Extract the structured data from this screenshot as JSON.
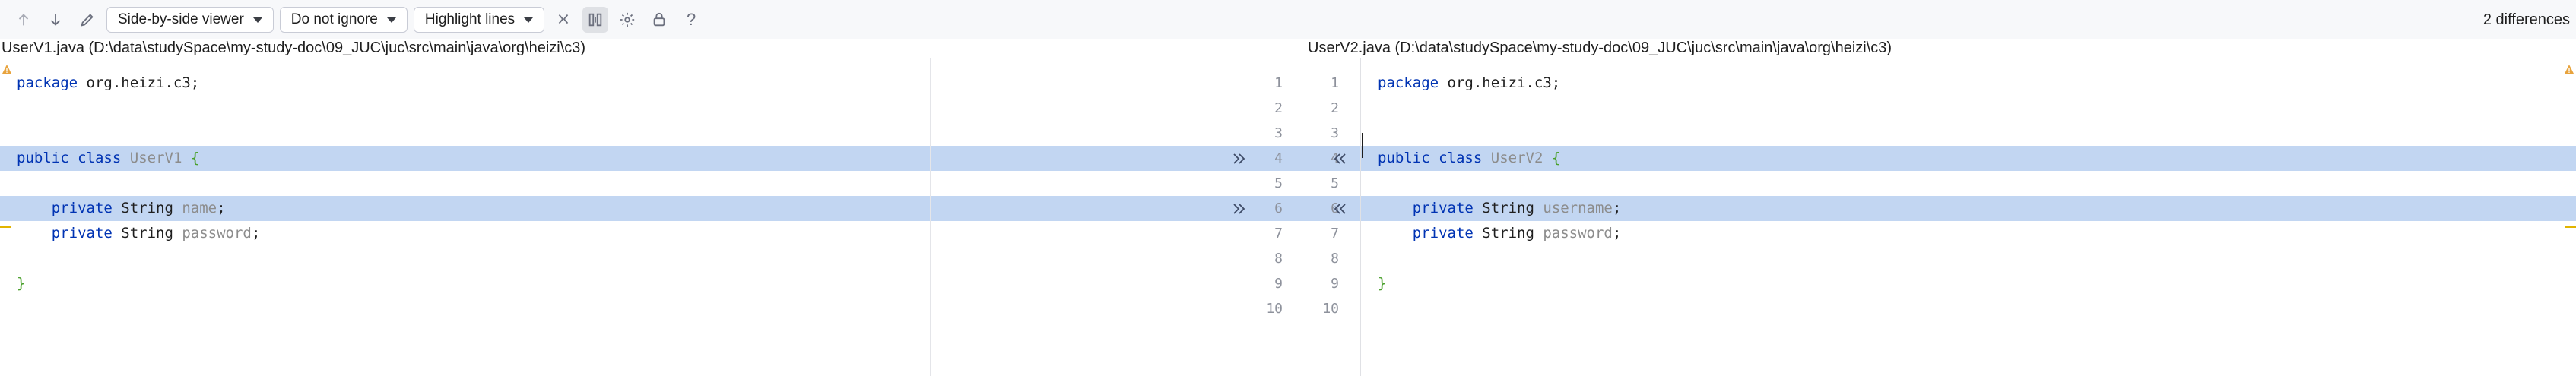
{
  "toolbar": {
    "viewer_label": "Side-by-side viewer",
    "ignore_label": "Do not ignore",
    "highlight_label": "Highlight lines",
    "diff_count": "2 differences",
    "help_label": "?"
  },
  "left": {
    "header": "UserV1.java (D:\\data\\studySpace\\my-study-doc\\09_JUC\\juc\\src\\main\\java\\org\\heizi\\c3)",
    "lines": [
      {
        "n": 1,
        "tokens": [
          {
            "t": "package",
            "c": "kw"
          },
          {
            "t": " org.heizi.c3;",
            "c": ""
          }
        ]
      },
      {
        "n": 2,
        "tokens": []
      },
      {
        "n": 3,
        "tokens": []
      },
      {
        "n": 4,
        "changed": true,
        "tokens": [
          {
            "t": "public",
            "c": "kw"
          },
          {
            "t": " ",
            "c": ""
          },
          {
            "t": "class",
            "c": "kw"
          },
          {
            "t": " ",
            "c": ""
          },
          {
            "t": "UserV1",
            "c": "cls"
          },
          {
            "t": " ",
            "c": ""
          },
          {
            "t": "{",
            "c": "brace"
          }
        ]
      },
      {
        "n": 5,
        "tokens": []
      },
      {
        "n": 6,
        "changed": true,
        "tokens": [
          {
            "t": "    ",
            "c": ""
          },
          {
            "t": "private",
            "c": "kw"
          },
          {
            "t": " String ",
            "c": ""
          },
          {
            "t": "name",
            "c": "fld"
          },
          {
            "t": ";",
            "c": ""
          }
        ]
      },
      {
        "n": 7,
        "tokens": [
          {
            "t": "    ",
            "c": ""
          },
          {
            "t": "private",
            "c": "kw"
          },
          {
            "t": " String ",
            "c": ""
          },
          {
            "t": "password",
            "c": "fld"
          },
          {
            "t": ";",
            "c": ""
          }
        ]
      },
      {
        "n": 8,
        "tokens": []
      },
      {
        "n": 9,
        "tokens": [
          {
            "t": "}",
            "c": "brace"
          }
        ]
      },
      {
        "n": 10,
        "tokens": []
      }
    ]
  },
  "right": {
    "header": "UserV2.java (D:\\data\\studySpace\\my-study-doc\\09_JUC\\juc\\src\\main\\java\\org\\heizi\\c3)",
    "lines": [
      {
        "n": 1,
        "tokens": [
          {
            "t": "package",
            "c": "kw"
          },
          {
            "t": " org.heizi.c3;",
            "c": ""
          }
        ]
      },
      {
        "n": 2,
        "tokens": []
      },
      {
        "n": 3,
        "tokens": []
      },
      {
        "n": 4,
        "changed": true,
        "tokens": [
          {
            "t": "public",
            "c": "kw"
          },
          {
            "t": " ",
            "c": ""
          },
          {
            "t": "class",
            "c": "kw"
          },
          {
            "t": " ",
            "c": ""
          },
          {
            "t": "UserV2",
            "c": "cls"
          },
          {
            "t": " ",
            "c": ""
          },
          {
            "t": "{",
            "c": "brace"
          }
        ]
      },
      {
        "n": 5,
        "tokens": []
      },
      {
        "n": 6,
        "changed": true,
        "tokens": [
          {
            "t": "    ",
            "c": ""
          },
          {
            "t": "private",
            "c": "kw"
          },
          {
            "t": " String ",
            "c": ""
          },
          {
            "t": "username",
            "c": "fld"
          },
          {
            "t": ";",
            "c": ""
          }
        ]
      },
      {
        "n": 7,
        "tokens": [
          {
            "t": "    ",
            "c": ""
          },
          {
            "t": "private",
            "c": "kw"
          },
          {
            "t": " String ",
            "c": ""
          },
          {
            "t": "password",
            "c": "fld"
          },
          {
            "t": ";",
            "c": ""
          }
        ]
      },
      {
        "n": 8,
        "tokens": []
      },
      {
        "n": 9,
        "tokens": [
          {
            "t": "}",
            "c": "brace"
          }
        ]
      },
      {
        "n": 10,
        "tokens": []
      }
    ]
  },
  "icons": {
    "prev": "arrow-up-icon",
    "next": "arrow-down-icon",
    "edit": "pencil-icon",
    "collapse": "collapse-icon",
    "sync": "sync-scroll-icon",
    "settings": "gear-icon",
    "lock": "lock-icon",
    "apply_left": "double-chevron-right-icon",
    "apply_right": "double-chevron-left-icon",
    "warning": "warning-icon"
  },
  "colors": {
    "changed_bg": "#c2d6f2",
    "keyword": "#0033b3",
    "brace": "#4aa02c",
    "identifier_dim": "#8c8c8c",
    "warning": "#e8a33d",
    "change_marker": "#e2b400"
  }
}
